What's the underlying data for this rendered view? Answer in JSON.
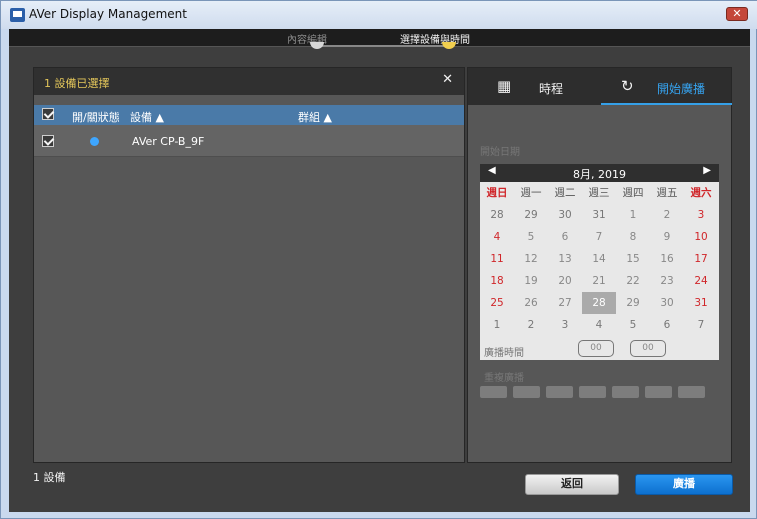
{
  "window": {
    "title": "AVer Display Management",
    "close_glyph": "✕",
    "close_color": "#c4473a"
  },
  "wizard": {
    "step1_label": "內容編輯",
    "step2_label": "選擇設備與時間",
    "active_color": "#f1cf4f",
    "inactive_color": "#d7d7d7"
  },
  "devices_panel": {
    "selection_text": "1 設備已選擇",
    "close_glyph": "✕",
    "headers": {
      "status": "開/關狀態",
      "device": "設備 ▲",
      "group": "群組 ▲"
    },
    "rows": [
      {
        "device_name": "AVer CP-B_9F",
        "status_color": "#3ea6ff"
      }
    ],
    "footer_count": "1 設備"
  },
  "schedule_panel": {
    "tabs": [
      {
        "icon": "calendar-icon",
        "glyph": "▦",
        "label": "時程",
        "active": false
      },
      {
        "icon": "refresh-icon",
        "glyph": "↻",
        "label": "開始廣播",
        "active": true
      }
    ],
    "start_date_label": "開始日期",
    "calendar": {
      "month_label": "8月, 2019",
      "prev_arrow": "◀",
      "next_arrow": "▶",
      "weekdays": [
        "週日",
        "週一",
        "週二",
        "週三",
        "週四",
        "週五",
        "週六"
      ],
      "weeks": [
        [
          "28",
          "29",
          "30",
          "31",
          "1",
          "2",
          "3"
        ],
        [
          "4",
          "5",
          "6",
          "7",
          "8",
          "9",
          "10"
        ],
        [
          "11",
          "12",
          "13",
          "14",
          "15",
          "16",
          "17"
        ],
        [
          "18",
          "19",
          "20",
          "21",
          "22",
          "23",
          "24"
        ],
        [
          "25",
          "26",
          "27",
          "28",
          "29",
          "30",
          "31"
        ],
        [
          "1",
          "2",
          "3",
          "4",
          "5",
          "6",
          "7"
        ]
      ],
      "selected_day": "28"
    },
    "broadcast_time_label": "廣播時間",
    "hour_value": "00",
    "minute_value": "00",
    "repeat_label": "重複廣播"
  },
  "buttons": {
    "back": "返回",
    "broadcast": "廣播"
  }
}
